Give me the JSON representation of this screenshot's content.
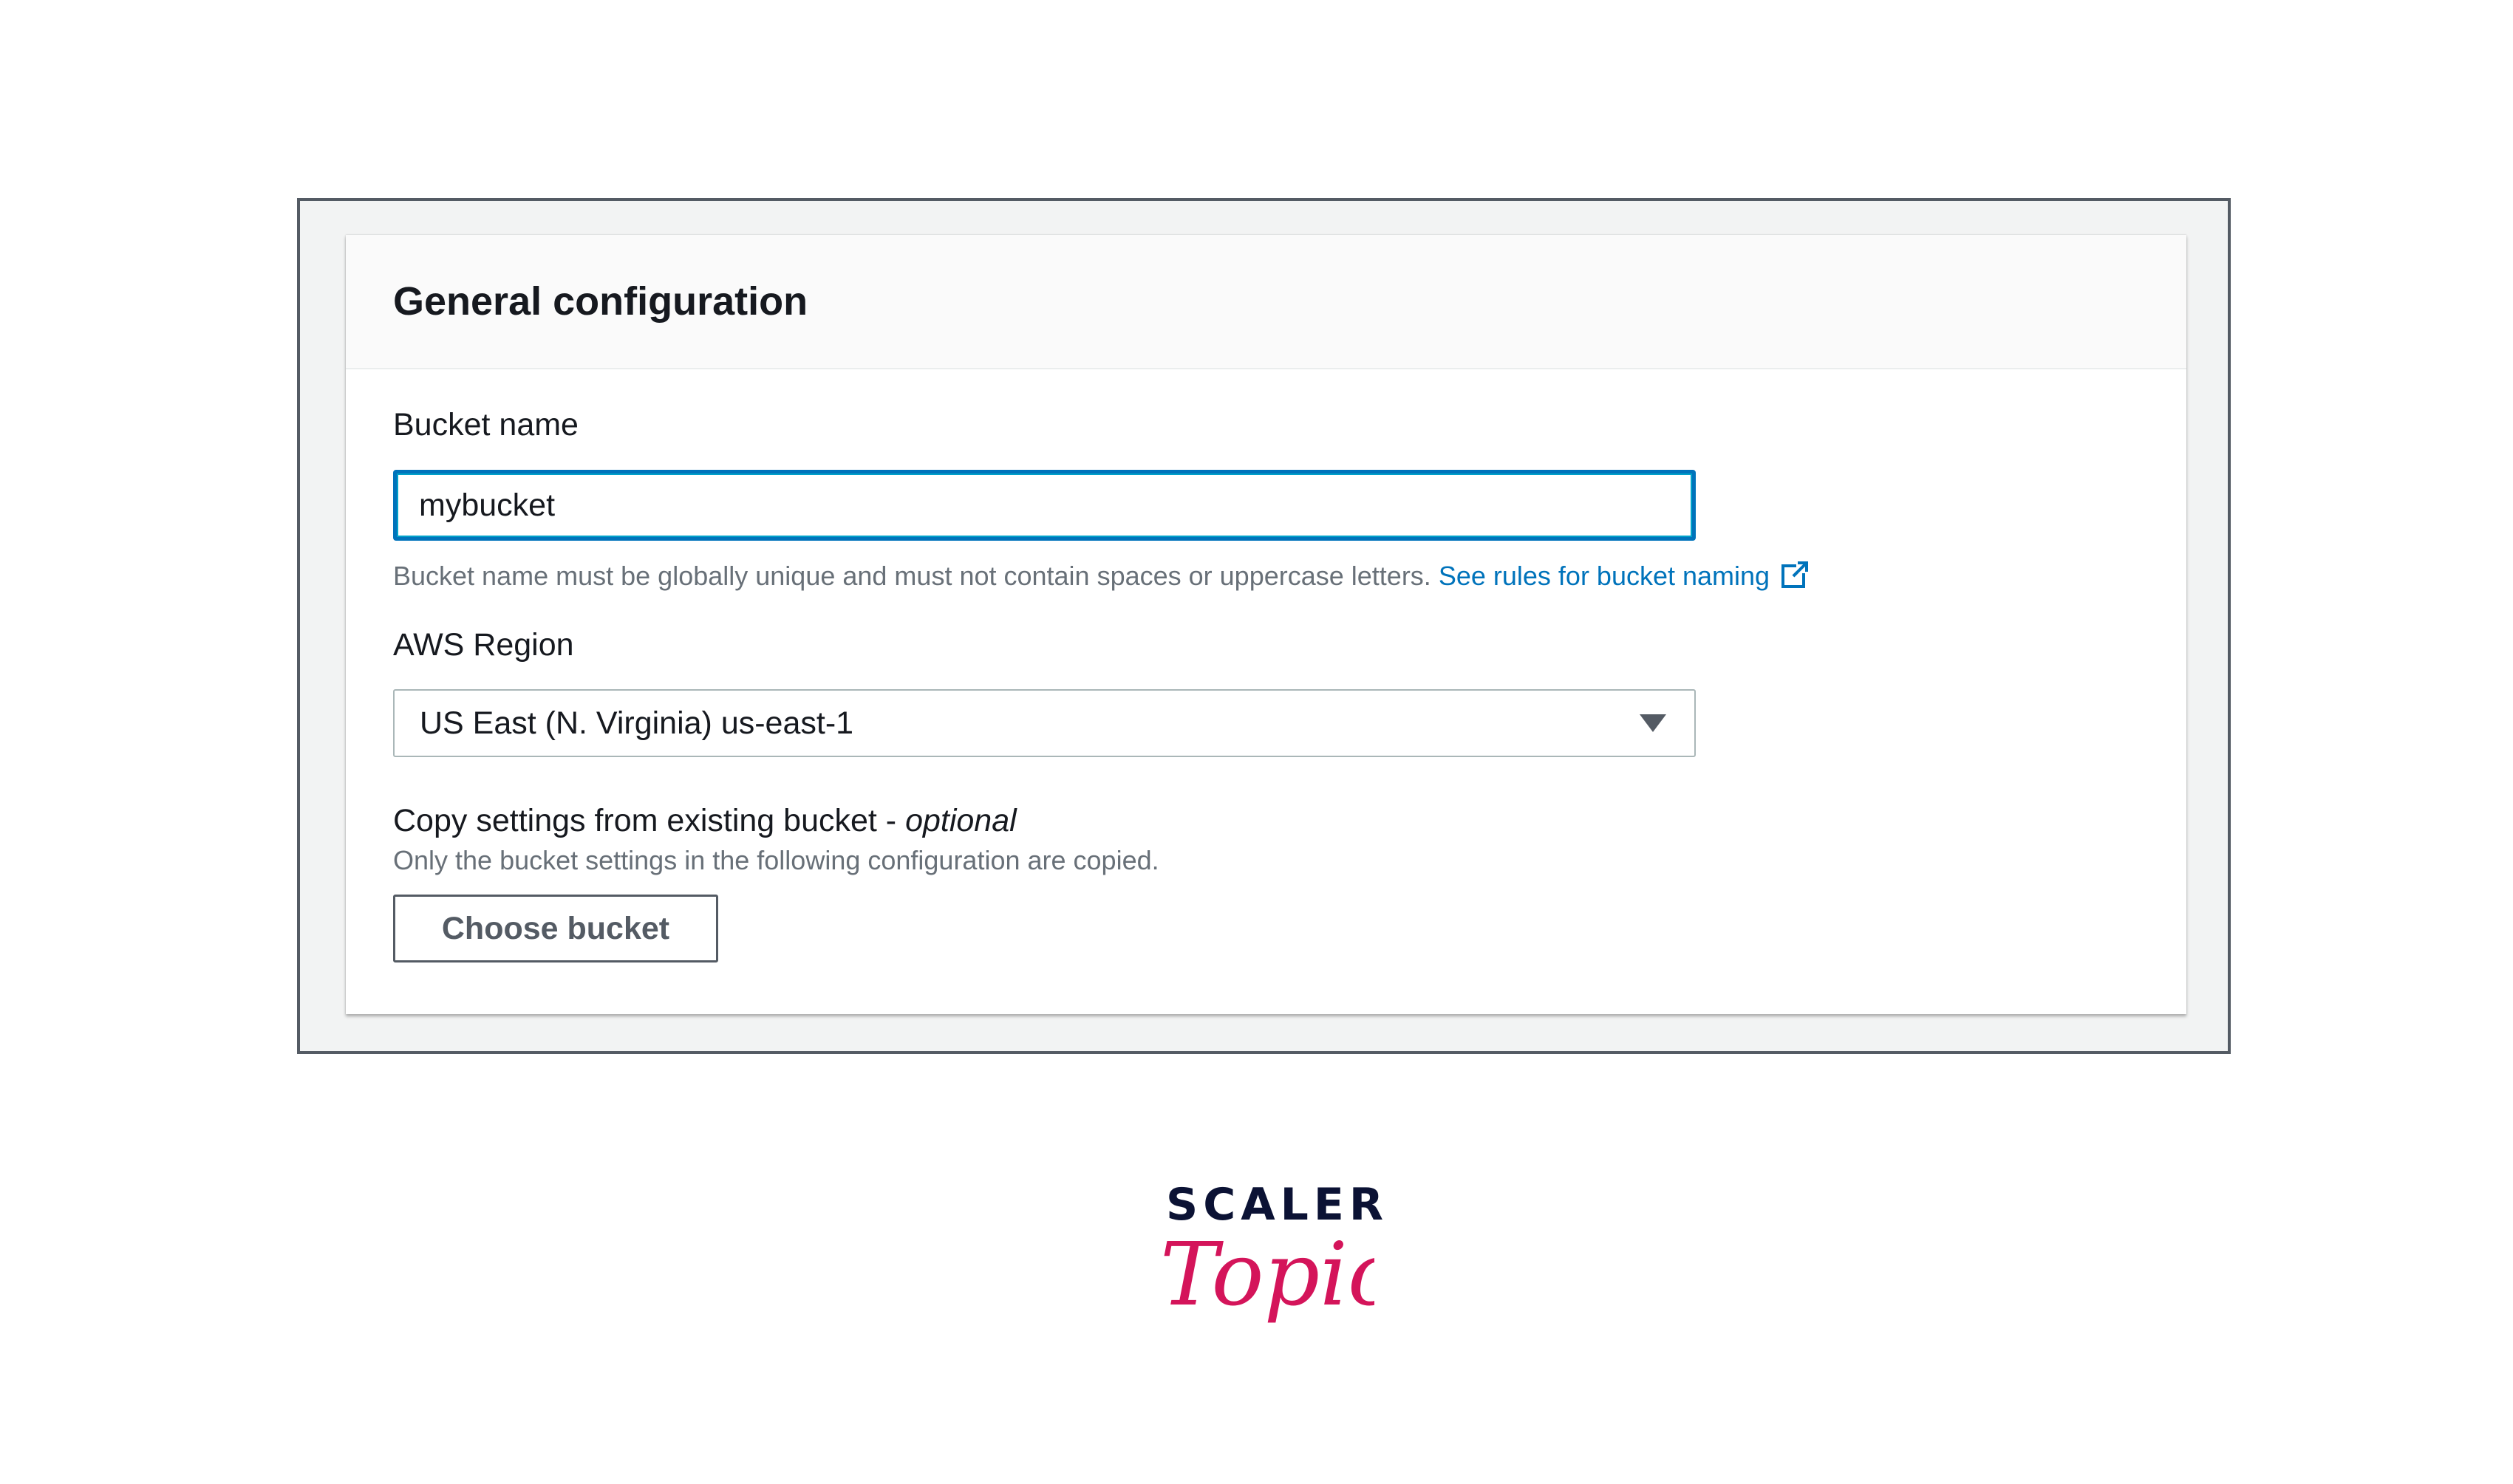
{
  "panel": {
    "title": "General configuration"
  },
  "bucket_name": {
    "label": "Bucket name",
    "value": "mybucket",
    "hint": "Bucket name must be globally unique and must not contain spaces or uppercase letters.",
    "hint_link": "See rules for bucket naming",
    "hint_link_icon": "external-link-icon"
  },
  "region": {
    "label": "AWS Region",
    "selected": "US East (N. Virginia) us-east-1",
    "caret_icon": "caret-down-icon"
  },
  "copy_settings": {
    "label": "Copy settings from existing bucket - ",
    "label_optional": "optional",
    "description": "Only the bucket settings in the following configuration are copied.",
    "button_label": "Choose bucket"
  },
  "logo": {
    "line1": "SCALER",
    "line2": "Topics"
  },
  "colors": {
    "accent": "#0073bb",
    "focus": "#00a1c9",
    "logo_dark": "#0b1234",
    "logo_pink": "#d4145a"
  }
}
